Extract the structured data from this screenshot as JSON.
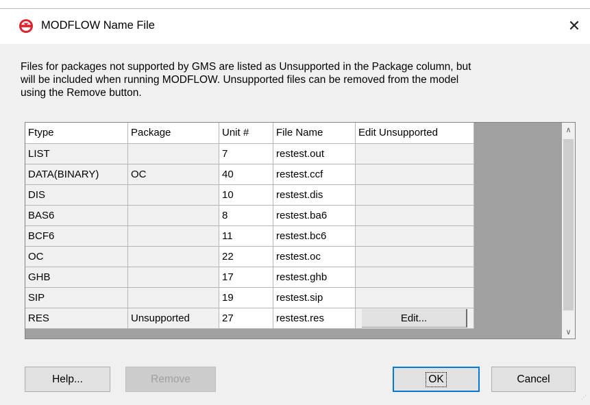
{
  "dialog": {
    "title": "MODFLOW Name File",
    "close_glyph": "✕",
    "icon": "gms-logo-icon",
    "accent_color": "#d9232e"
  },
  "description": [
    "Files for packages not supported by GMS are listed as Unsupported in the Package column, but",
    "will be included when running MODFLOW.  Unsupported files can be removed from the model",
    "using the Remove button."
  ],
  "table": {
    "columns": [
      "Ftype",
      "Package",
      "Unit #",
      "File Name",
      "Edit Unsupported"
    ],
    "rows": [
      {
        "ftype": "LIST",
        "package": "",
        "unit": "7",
        "file": "restest.out",
        "edit": ""
      },
      {
        "ftype": "DATA(BINARY)",
        "package": "OC",
        "unit": "40",
        "file": "restest.ccf",
        "edit": ""
      },
      {
        "ftype": "DIS",
        "package": "",
        "unit": "10",
        "file": "restest.dis",
        "edit": ""
      },
      {
        "ftype": "BAS6",
        "package": "",
        "unit": "8",
        "file": "restest.ba6",
        "edit": ""
      },
      {
        "ftype": "BCF6",
        "package": "",
        "unit": "11",
        "file": "restest.bc6",
        "edit": ""
      },
      {
        "ftype": "OC",
        "package": "",
        "unit": "22",
        "file": "restest.oc",
        "edit": ""
      },
      {
        "ftype": "GHB",
        "package": "",
        "unit": "17",
        "file": "restest.ghb",
        "edit": ""
      },
      {
        "ftype": "SIP",
        "package": "",
        "unit": "19",
        "file": "restest.sip",
        "edit": ""
      },
      {
        "ftype": "RES",
        "package": "Unsupported",
        "unit": "27",
        "file": "restest.res",
        "edit": "Edit..."
      }
    ]
  },
  "scrollbar": {
    "up_glyph": "∧",
    "down_glyph": "∨"
  },
  "buttons": {
    "help": "Help...",
    "remove": "Remove",
    "ok": "OK",
    "cancel": "Cancel"
  }
}
